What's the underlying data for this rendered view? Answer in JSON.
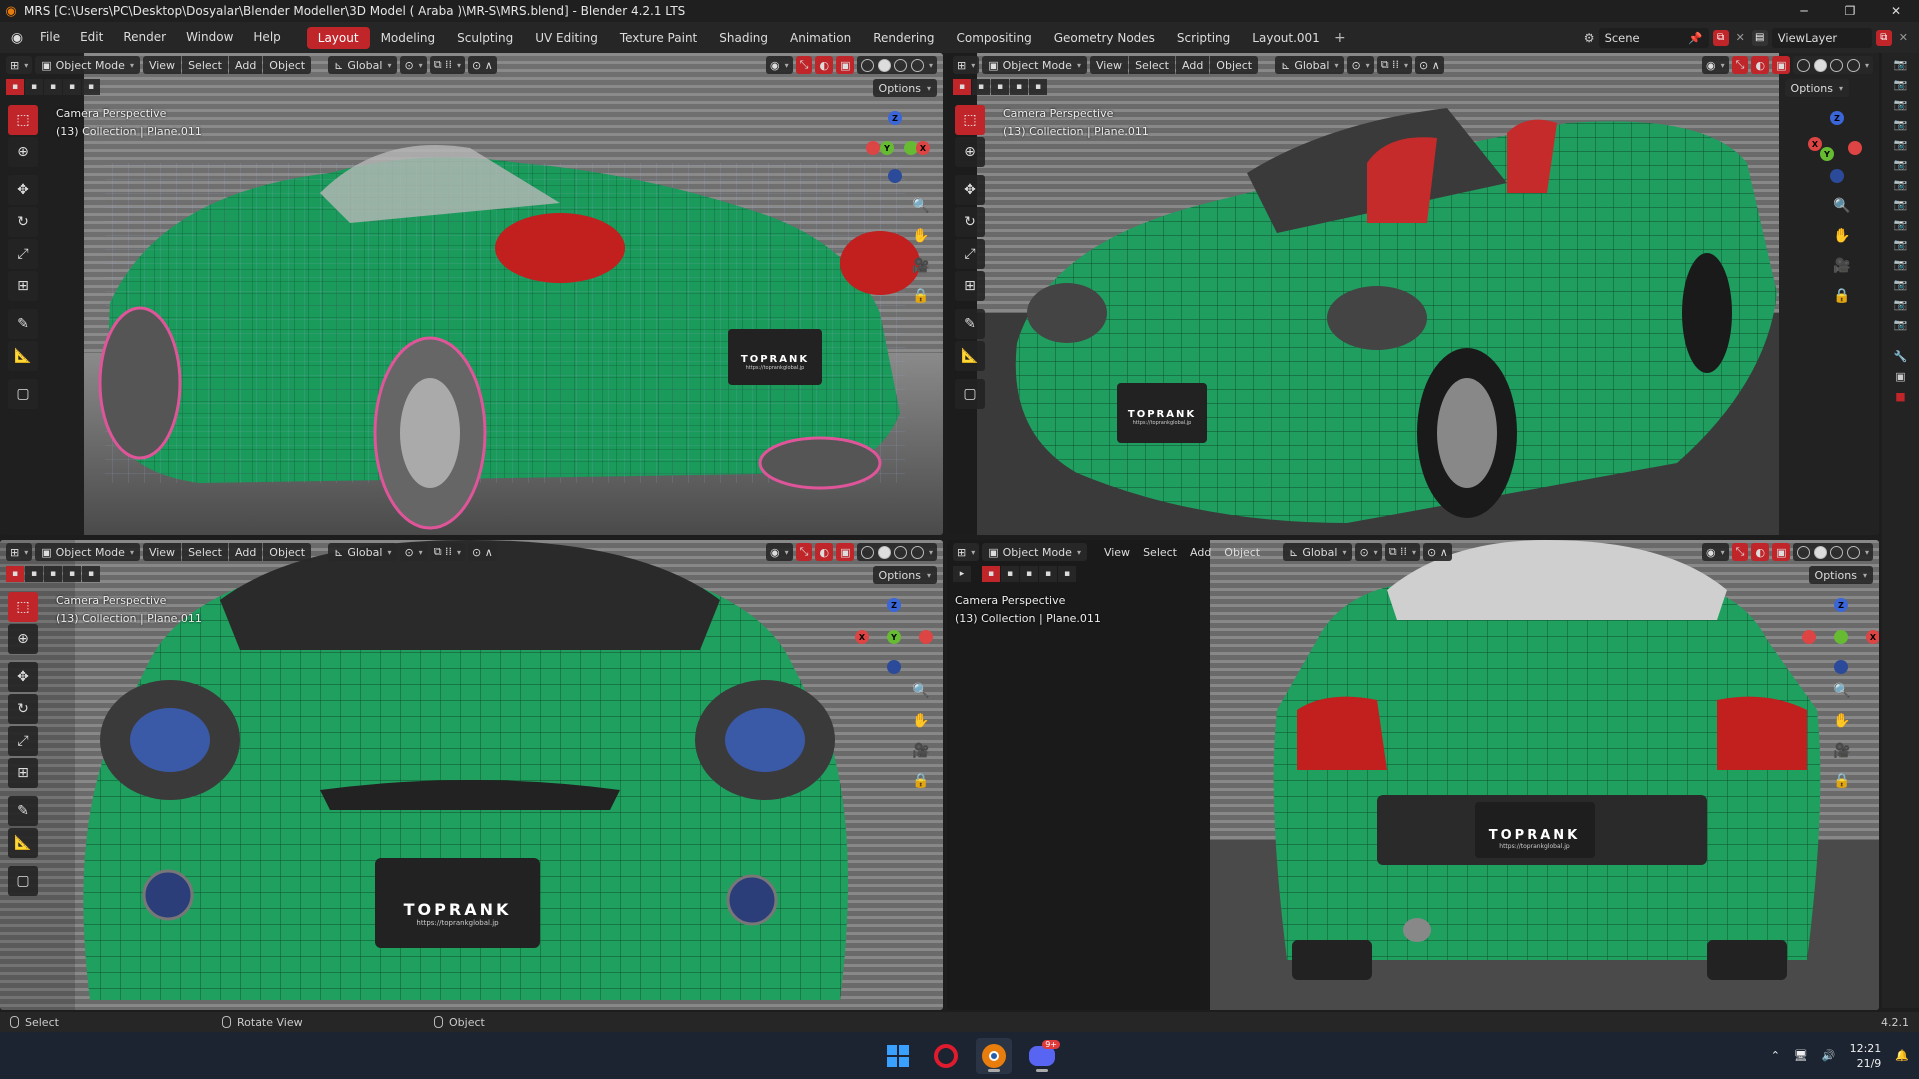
{
  "window": {
    "title": "MRS [C:\\Users\\PC\\Desktop\\Dosyalar\\Blender Modeller\\3D Model ( Araba )\\MR-S\\MRS.blend] - Blender 4.2.1 LTS",
    "minimize": "─",
    "maximize": "❐",
    "close": "✕"
  },
  "menu": [
    "File",
    "Edit",
    "Render",
    "Window",
    "Help"
  ],
  "workspaces": [
    "Layout",
    "Modeling",
    "Sculpting",
    "UV Editing",
    "Texture Paint",
    "Shading",
    "Animation",
    "Rendering",
    "Compositing",
    "Geometry Nodes",
    "Scripting",
    "Layout.001"
  ],
  "active_workspace": "Layout",
  "scene": {
    "name": "Scene",
    "view_layer": "ViewLayer"
  },
  "viewport_header": {
    "mode": "Object Mode",
    "view": "View",
    "select": "Select",
    "add": "Add",
    "object": "Object",
    "orientation": "Global",
    "options": "Options"
  },
  "viewports": [
    {
      "camera": "Camera Perspective",
      "collection": "(13) Collection | Plane.011",
      "plate": "TOPRANK",
      "plate_url": "https://toprankglobal.jp"
    },
    {
      "camera": "Camera Perspective",
      "collection": "(13) Collection | Plane.011",
      "plate": "TOPRANK",
      "plate_url": "https://toprankglobal.jp"
    },
    {
      "camera": "Camera Perspective",
      "collection": "(13) Collection | Plane.011",
      "plate": "TOPRANK",
      "plate_url": "https://toprankglobal.jp"
    },
    {
      "camera": "Camera Perspective",
      "collection": "(13) Collection | Plane.011",
      "plate": "TOPRANK",
      "plate_url": "https://toprankglobal.jp"
    }
  ],
  "status": {
    "select": "Select",
    "rotate": "Rotate View",
    "object": "Object",
    "version": "4.2.1"
  },
  "taskbar": {
    "time": "12:21",
    "date": "21/9",
    "discord_badge": "9+"
  },
  "colors": {
    "accent": "#c0252a",
    "car_green": "#1fa863",
    "wire": "#0a2a16",
    "taskbar": "#1c2431"
  }
}
